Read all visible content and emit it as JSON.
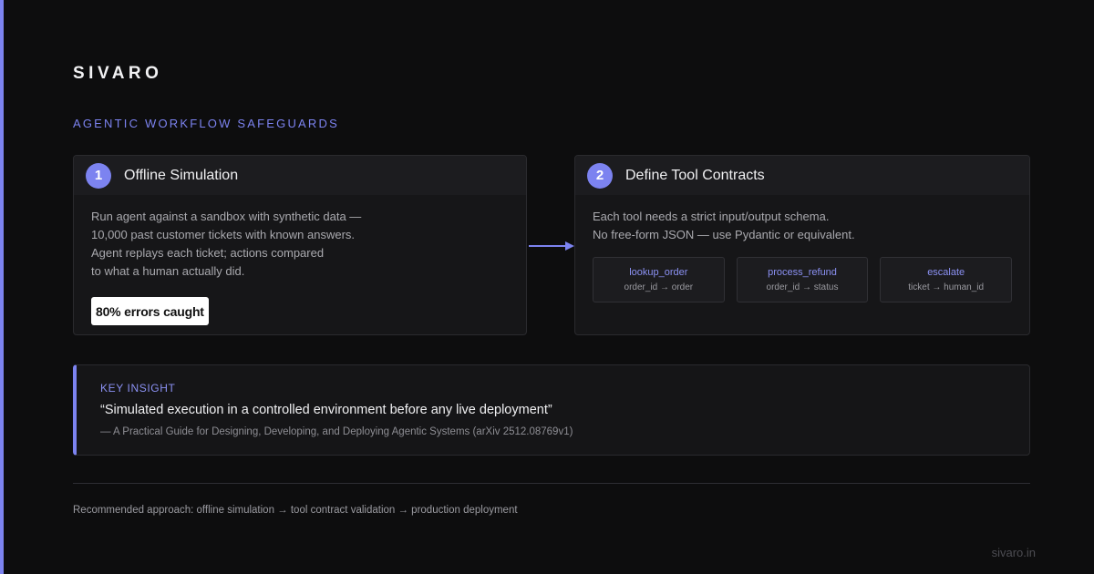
{
  "brand": "SIVARO",
  "section_label": "AGENTIC WORKFLOW SAFEGUARDS",
  "colors": {
    "accent": "#7c83f0",
    "background": "#0d0d0e",
    "card": "#161618"
  },
  "steps": [
    {
      "number": "1",
      "title": "Offline Simulation",
      "description": [
        "Run agent against a sandbox with synthetic data —",
        "10,000 past customer tickets with known answers.",
        "Agent replays each ticket; actions compared",
        "to what a human actually did."
      ],
      "stat": "80% errors caught"
    },
    {
      "number": "2",
      "title": "Define Tool Contracts",
      "description": [
        "Each tool needs a strict input/output schema.",
        "No free-form JSON — use Pydantic or equivalent."
      ],
      "tools": [
        {
          "name": "lookup_order",
          "signature": "order_id → order"
        },
        {
          "name": "process_refund",
          "signature": "order_id → status"
        },
        {
          "name": "escalate",
          "signature": "ticket → human_id"
        }
      ]
    }
  ],
  "insight": {
    "label": "KEY INSIGHT",
    "quote": "“Simulated execution in a controlled environment before any live deployment”",
    "source": "— A Practical Guide for Designing, Developing, and Deploying Agentic Systems (arXiv 2512.08769v1)"
  },
  "footer_note": "Recommended approach: offline simulation → tool contract validation → production deployment",
  "site_url": "sivaro.in"
}
